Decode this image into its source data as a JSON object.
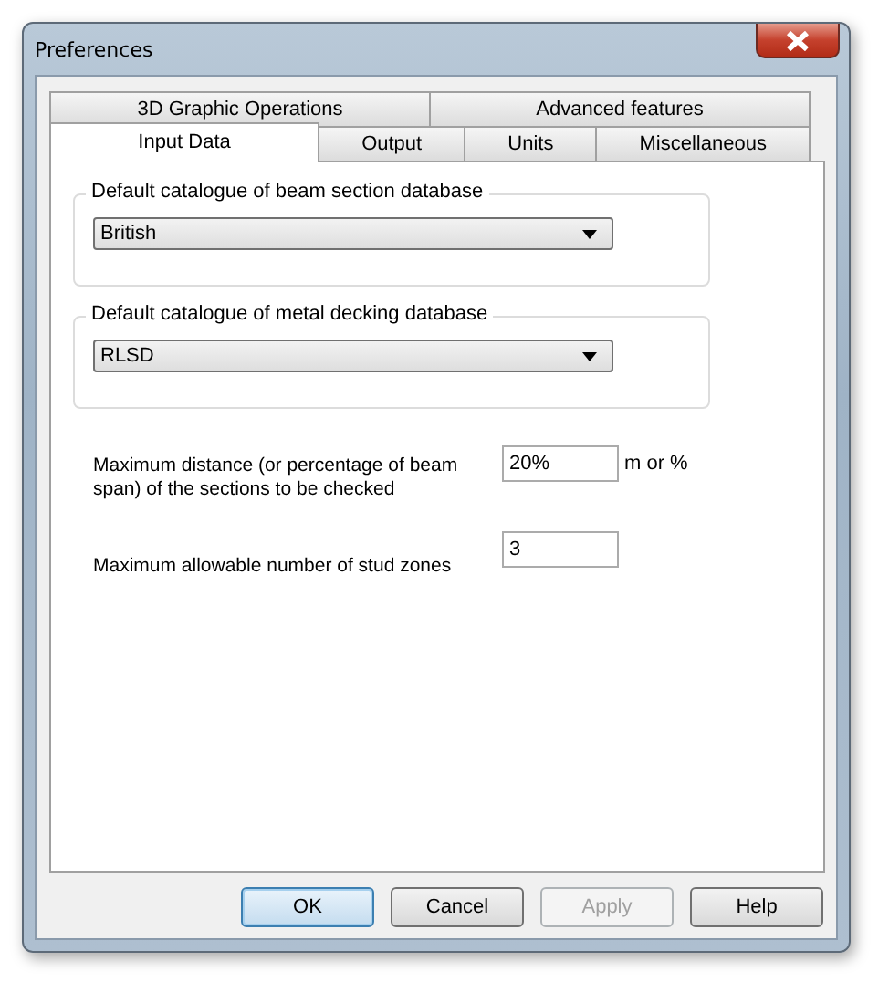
{
  "window": {
    "title": "Preferences"
  },
  "tab_rows": [
    [
      {
        "label": "3D Graphic Operations",
        "selected": false
      },
      {
        "label": "Advanced features",
        "selected": false
      }
    ],
    [
      {
        "label": "Input Data",
        "selected": true
      },
      {
        "label": "Output",
        "selected": false
      },
      {
        "label": "Units",
        "selected": false
      },
      {
        "label": "Miscellaneous",
        "selected": false
      }
    ]
  ],
  "groups": [
    {
      "legend": "Default catalogue of beam section database",
      "value": "British"
    },
    {
      "legend": "Default catalogue of metal decking database",
      "value": "RLSD"
    }
  ],
  "fields": [
    {
      "label": "Maximum distance (or percentage of beam span) of the sections to be checked",
      "value": "20%",
      "unit": "m or %"
    },
    {
      "label": "Maximum allowable number of stud zones",
      "value": "3"
    }
  ],
  "buttons": [
    {
      "label": "OK",
      "default": true,
      "disabled": false
    },
    {
      "label": "Cancel",
      "default": false,
      "disabled": false
    },
    {
      "label": "Apply",
      "default": false,
      "disabled": true
    },
    {
      "label": "Help",
      "default": false,
      "disabled": false
    }
  ]
}
